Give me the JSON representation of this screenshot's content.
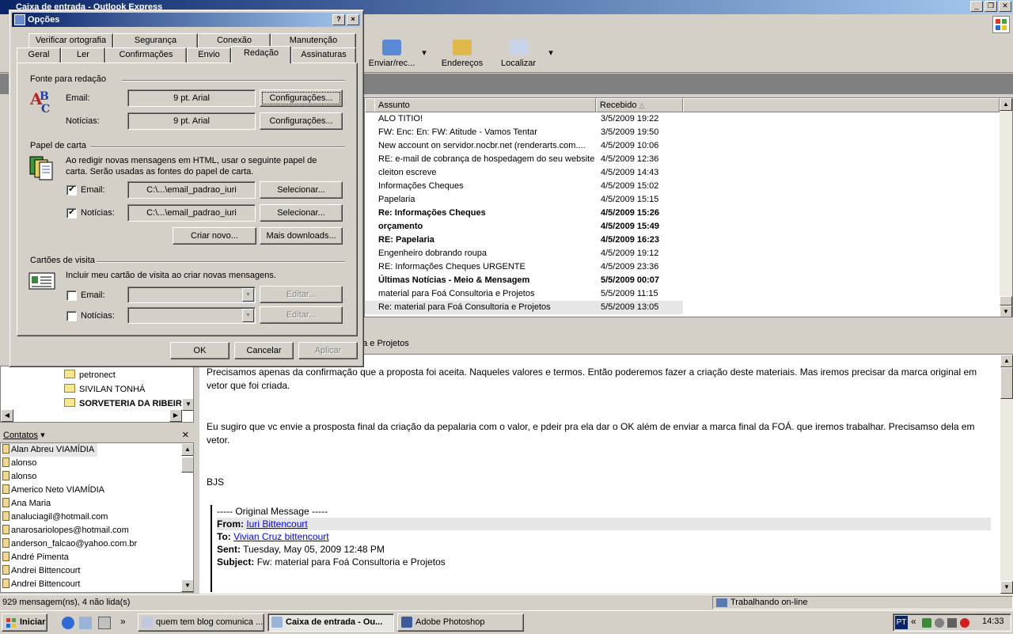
{
  "outlook": {
    "title": "Caixa de entrada - Outlook Express",
    "toolbar": {
      "send_receive": "Enviar/rec...",
      "addresses": "Endereços",
      "find": "Localizar"
    },
    "columns": {
      "subject": "Assunto",
      "received": "Recebido"
    },
    "messages": [
      {
        "subject": "ALO TITIO!",
        "date": "3/5/2009 19:22",
        "bold": false
      },
      {
        "subject": "FW: Enc: En: FW: Atitude - Vamos Tentar",
        "date": "3/5/2009 19:50",
        "bold": false
      },
      {
        "subject": "New account on servidor.nocbr.net (renderarts.com....",
        "date": "4/5/2009 10:06",
        "bold": false
      },
      {
        "subject": "RE: e-mail de cobrança de hospedagem do seu website",
        "date": "4/5/2009 12:36",
        "bold": false
      },
      {
        "subject": "cleiton escreve",
        "date": "4/5/2009 14:43",
        "bold": false
      },
      {
        "subject": "Informações Cheques",
        "date": "4/5/2009 15:02",
        "bold": false
      },
      {
        "subject": "Papelaria",
        "date": "4/5/2009 15:15",
        "bold": false
      },
      {
        "subject": "Re: Informações Cheques",
        "date": "4/5/2009 15:26",
        "bold": true
      },
      {
        "subject": "orçamento",
        "date": "4/5/2009 15:49",
        "bold": true
      },
      {
        "subject": "RE: Papelaria",
        "date": "4/5/2009 16:23",
        "bold": true
      },
      {
        "subject": "Engenheiro dobrando roupa",
        "date": "4/5/2009 19:12",
        "bold": false
      },
      {
        "subject": "RE: Informações Cheques URGENTE",
        "date": "4/5/2009 23:36",
        "bold": false
      },
      {
        "subject": "Últimas Notícias - Meio & Mensagem",
        "date": "5/5/2009 00:07",
        "bold": true
      },
      {
        "subject": "material  para Foá Consultoria e Projetos",
        "date": "5/5/2009 11:15",
        "bold": false
      },
      {
        "subject": "Re: material  para Foá Consultoria e Projetos",
        "date": "5/5/2009 13:05",
        "bold": false
      }
    ],
    "preview_header": "ria e Projetos",
    "body": {
      "p1": "Precisamos apenas da confirmação que a proposta foi aceita. Naqueles valores e termos. Então poderemos fazer a criação deste materiais. Mas iremos precisar da marca original em vetor que foi criada.",
      "p2": "Eu sugiro que vc envie a prosposta final da criação da pepalaria com o valor, e pdeir pra ela dar o OK além de enviar a marca final da FOÁ. que iremos trabalhar. Precisamso dela em vetor.",
      "p3": "BJS",
      "orig_title": "----- Original Message -----",
      "from_label": "From:",
      "from": "Iuri Bittencourt",
      "to_label": "To:",
      "to": "Vivian Cruz bittencourt",
      "sent_label": "Sent:",
      "sent": "Tuesday, May 05, 2009 12:48 PM",
      "subject_label": "Subject:",
      "subject": "Fw: material para Foá Consultoria e Projetos"
    },
    "folders": [
      "petronect",
      "SIVILAN TONHÁ",
      "SORVETERIA DA RIBEIR"
    ],
    "contacts_title": "Contatos",
    "contacts": [
      "Alan Abreu VIAMÍDIA",
      "alonso",
      "alonso",
      "Americo Neto VIAMÍDIA",
      "Ana Maria",
      "analuciagil@hotmail.com",
      "anarosariolopes@hotmail.com",
      "anderson_falcao@yahoo.com.br",
      "André Pimenta",
      "Andrei Bittencourt",
      "Andrei Bittencourt"
    ],
    "status_left": "929 mensagem(ns), 4 não lida(s)",
    "status_right": "Trabalhando on-line"
  },
  "taskbar": {
    "start": "Iniciar",
    "tasks": [
      "quem tem blog comunica ...",
      "Caixa de entrada - Ou...",
      "Adobe Photoshop"
    ],
    "lang": "PT",
    "clock": "14:33"
  },
  "dialog": {
    "title": "Opções",
    "help_btn": "?",
    "close_btn": "×",
    "tabs_row1": [
      "Verificar ortografia",
      "Segurança",
      "Conexão",
      "Manutenção"
    ],
    "tabs_row2": [
      "Geral",
      "Ler",
      "Confirmações",
      "Envio",
      "Redação",
      "Assinaturas"
    ],
    "active_tab": "Redação",
    "font_group": "Fonte para redação",
    "email_label": "Email:",
    "news_label": "Notícias:",
    "email_font": "9 pt. Arial",
    "news_font": "9 pt. Arial",
    "config_btn": "Configurações...",
    "stationery_group": "Papel de carta",
    "stationery_desc": "Ao redigir novas mensagens em HTML, usar o seguinte papel de carta. Serão usadas as fontes do papel de carta.",
    "email_stationery": "C:\\...\\email_padrao_iuri",
    "news_stationery": "C:\\...\\email_padrao_iuri",
    "select_btn": "Selecionar...",
    "create_btn": "Criar novo...",
    "more_btn": "Mais downloads...",
    "vcard_group": "Cartões de visita",
    "vcard_desc": "Incluir meu cartão de visita ao criar novas mensagens.",
    "edit_btn": "Editar...",
    "ok": "OK",
    "cancel": "Cancelar",
    "apply": "Aplicar"
  }
}
